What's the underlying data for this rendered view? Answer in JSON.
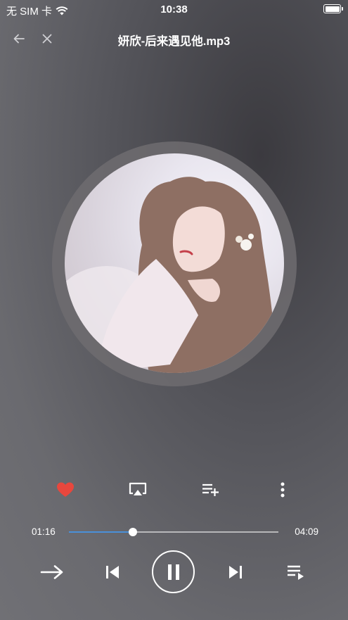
{
  "status_bar": {
    "carrier": "无 SIM 卡",
    "time": "10:38",
    "battery_level": 1.0
  },
  "nav": {
    "title": "妍欣-后来遇见他.mp3",
    "back_icon": "arrow-left-icon",
    "close_icon": "close-icon"
  },
  "album_art": {
    "description_icon": "album-cover-image"
  },
  "actions": {
    "favorite_icon": "heart-icon",
    "favorite_color": "#e8473d",
    "airplay_icon": "airplay-icon",
    "add_to_playlist_icon": "playlist-add-icon",
    "more_icon": "more-vertical-icon"
  },
  "progress": {
    "current": "01:16",
    "total": "04:09",
    "fraction": 0.305,
    "accent": "#4a90d9"
  },
  "controls": {
    "mode_icon": "arrow-right-icon",
    "prev_icon": "skip-previous-icon",
    "play_pause_icon": "pause-icon",
    "next_icon": "skip-next-icon",
    "queue_icon": "queue-music-icon"
  }
}
